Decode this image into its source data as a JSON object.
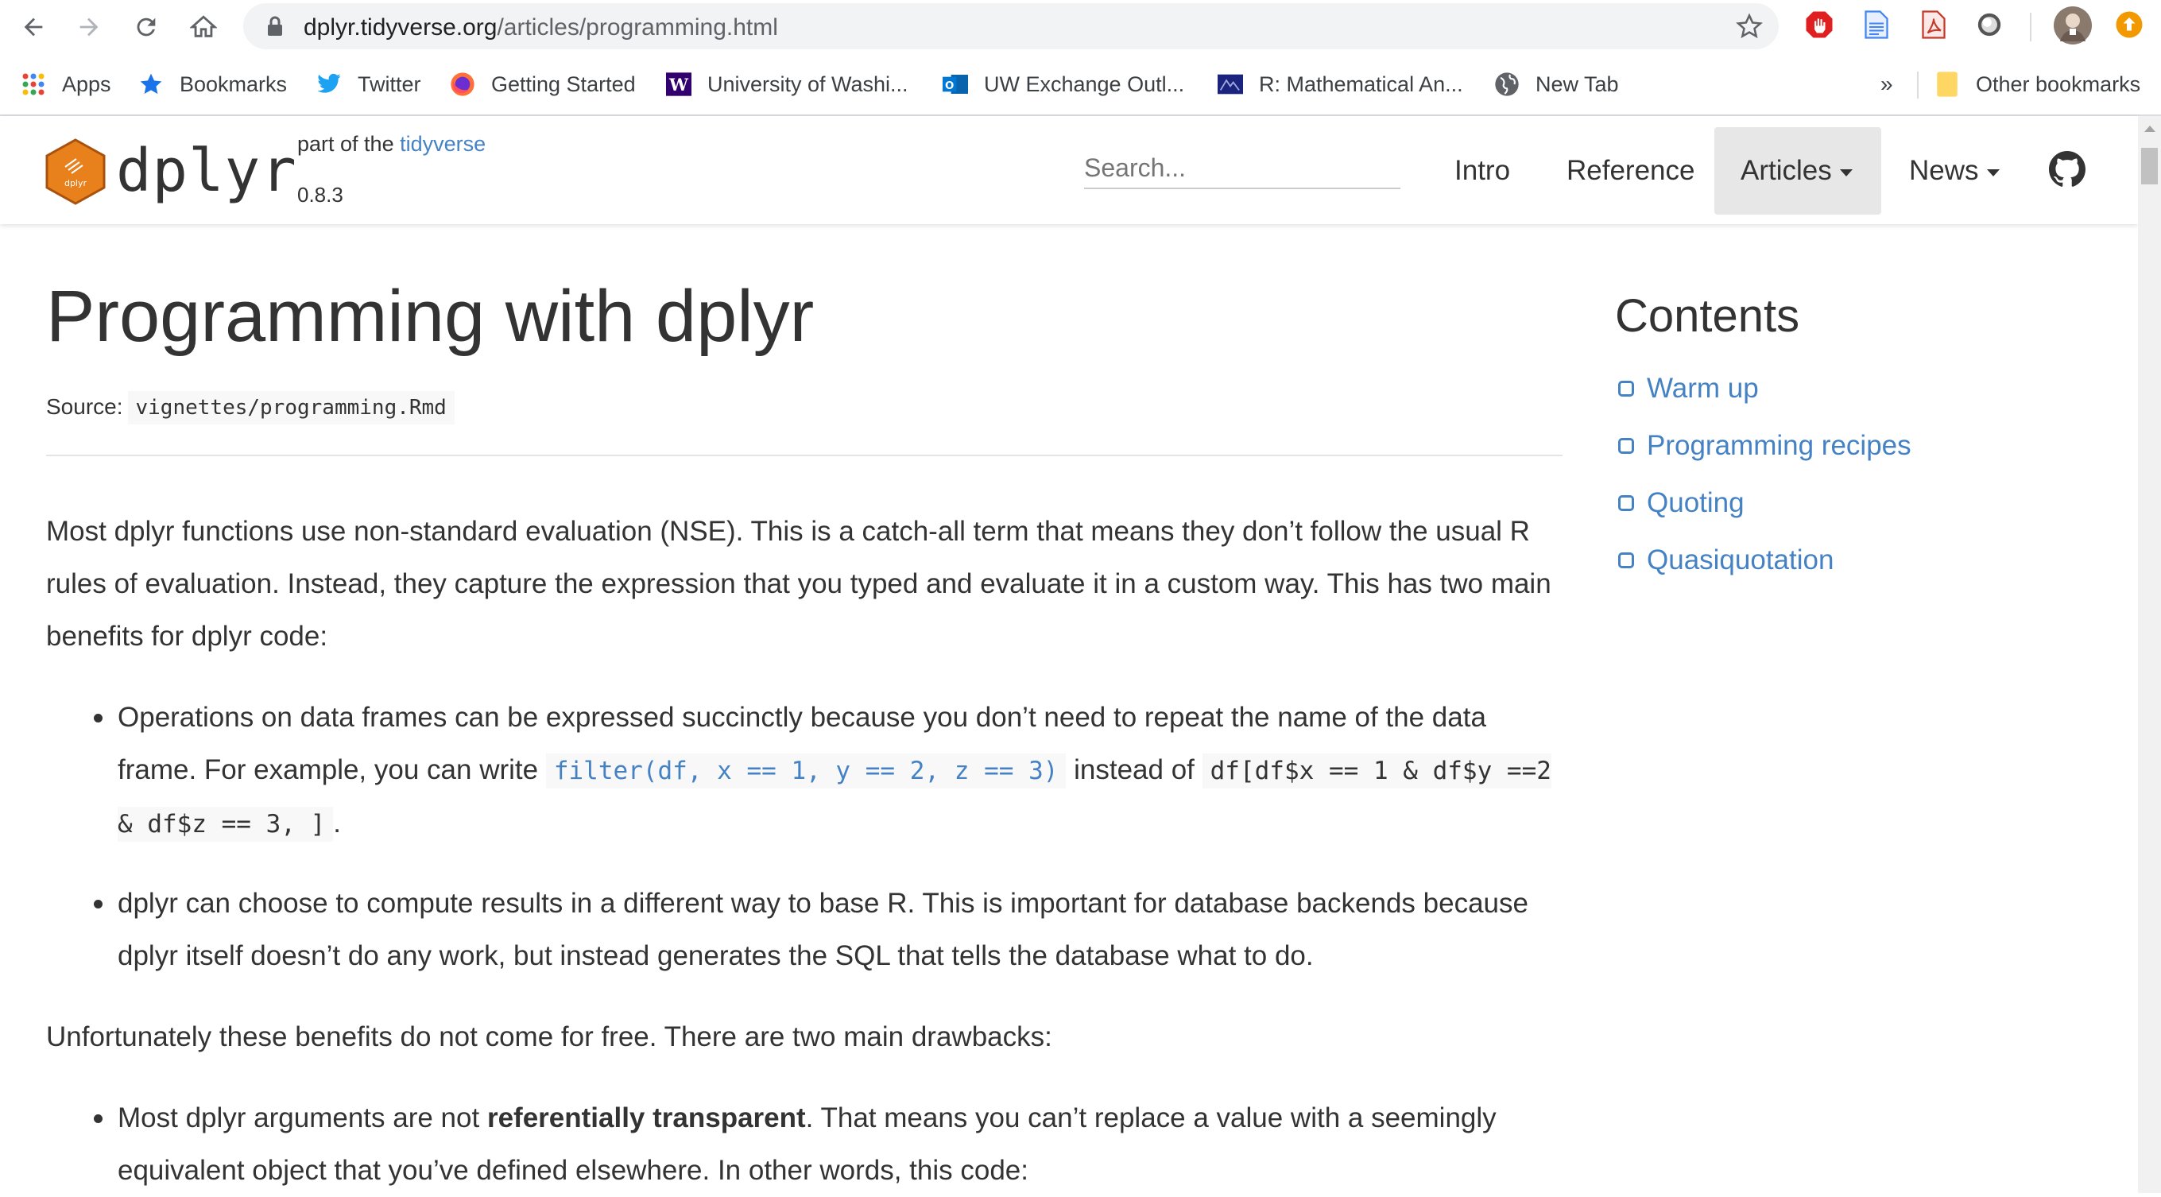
{
  "browser": {
    "url_domain": "dplyr.tidyverse.org",
    "url_path": "/articles/programming.html"
  },
  "bookmarks": {
    "apps": "Apps",
    "items": [
      {
        "label": "Bookmarks",
        "icon": "star-icon"
      },
      {
        "label": "Twitter",
        "icon": "twitter-icon"
      },
      {
        "label": "Getting Started",
        "icon": "firefox-icon"
      },
      {
        "label": "University of Washi...",
        "icon": "uw-icon"
      },
      {
        "label": "UW Exchange Outl...",
        "icon": "outlook-icon"
      },
      {
        "label": "R: Mathematical An...",
        "icon": "r-doc-icon"
      },
      {
        "label": "New Tab",
        "icon": "globe-icon"
      }
    ],
    "overflow": "»",
    "other": "Other bookmarks"
  },
  "site": {
    "brand": "dplyr",
    "logo_text": "dplyr",
    "part_of": "part of the",
    "tidyverse_link": "tidyverse",
    "version": "0.8.3",
    "search_placeholder": "Search...",
    "nav": {
      "intro": "Intro",
      "reference": "Reference",
      "articles": "Articles",
      "news": "News"
    },
    "accent_color": "#4582c4"
  },
  "article": {
    "title": "Programming with dplyr",
    "source_label": "Source:",
    "source_file": "vignettes/programming.Rmd",
    "intro": "Most dplyr functions use non-standard evaluation (NSE). This is a catch-all term that means they don’t follow the usual R rules of evaluation. Instead, they capture the expression that you typed and evaluate it in a custom way. This has two main benefits for dplyr code:",
    "benefit1_pre": "Operations on data frames can be expressed succinctly because you don’t need to repeat the name of the data frame. For example, you can write",
    "benefit1_code1": "filter(df, x == 1, y == 2, z == 3)",
    "benefit1_mid": "instead of",
    "benefit1_code2": "df[df$x == 1 & df$y ==2 & df$z == 3, ]",
    "benefit1_end": ".",
    "benefit2": "dplyr can choose to compute results in a different way to base R. This is important for database backends because dplyr itself doesn’t do any work, but instead generates the SQL that tells the database what to do.",
    "drawbacks": "Unfortunately these benefits do not come for free. There are two main drawbacks:",
    "drawback1_pre": "Most dplyr arguments are not",
    "drawback1_bold": "referentially transparent",
    "drawback1_post": ". That means you can’t replace a value with a seemingly equivalent object that you’ve defined elsewhere. In other words, this code:"
  },
  "toc": {
    "title": "Contents",
    "items": [
      "Warm up",
      "Programming recipes",
      "Quoting",
      "Quasiquotation"
    ]
  }
}
